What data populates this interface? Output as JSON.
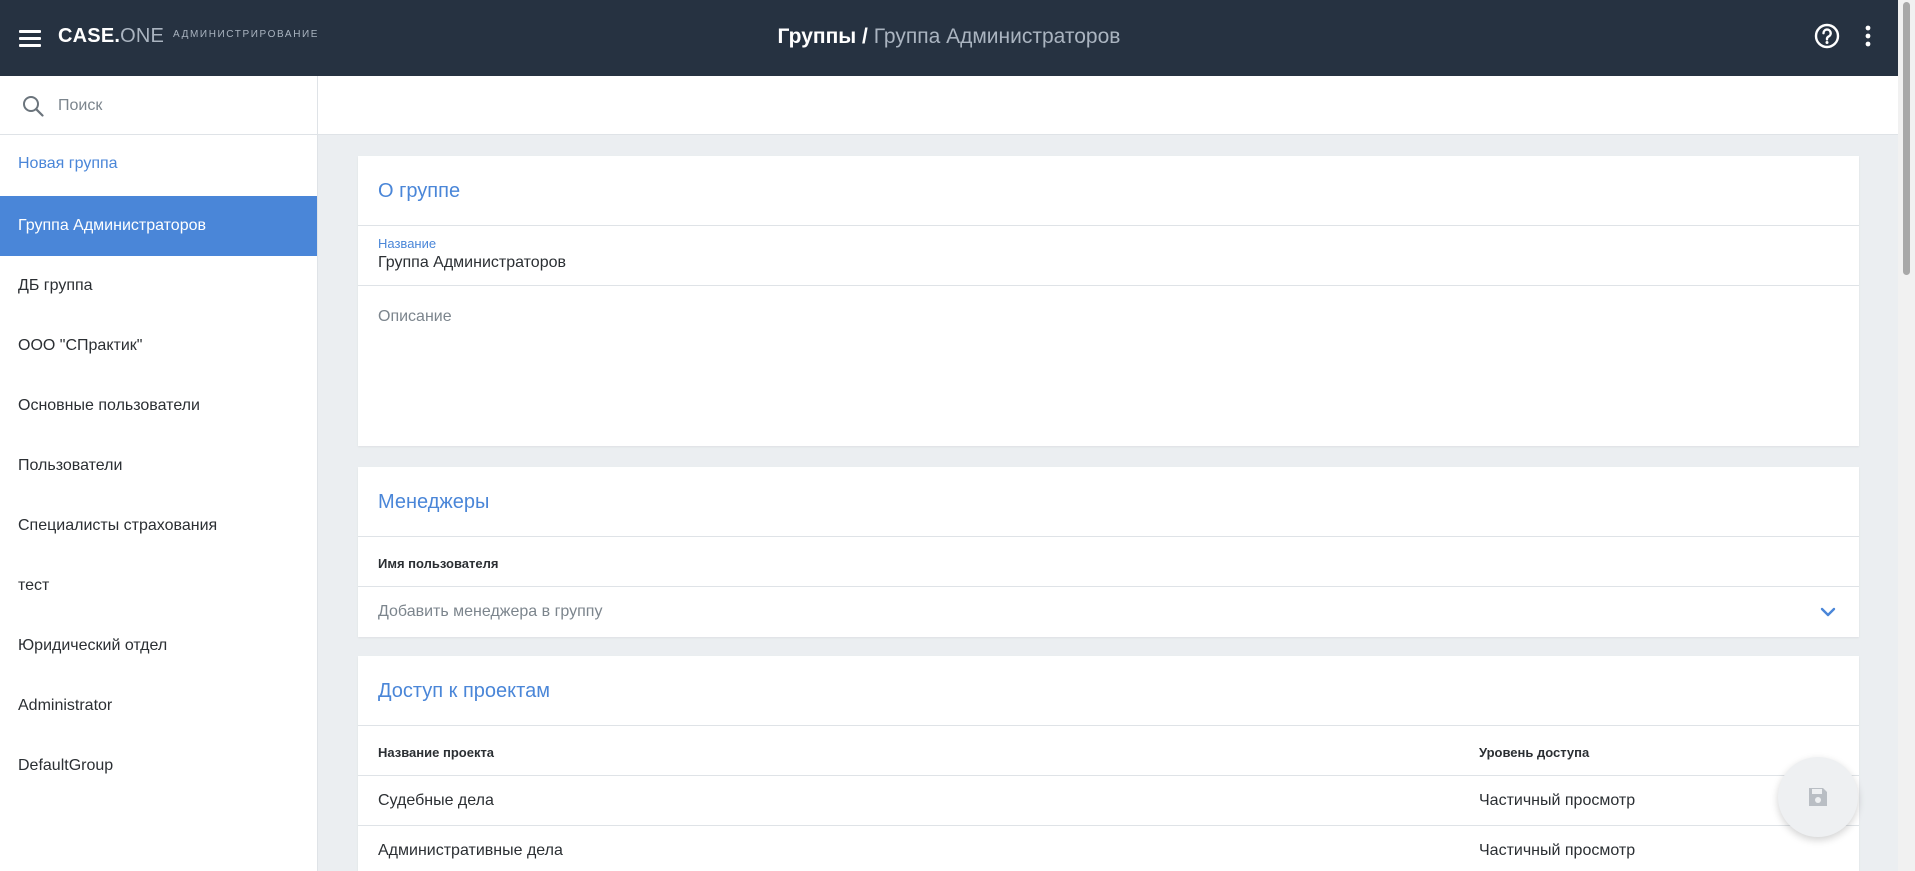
{
  "header": {
    "logo_primary": "CASE.",
    "logo_secondary": "ONE",
    "subtitle": "АДМИНИСТРИРОВАНИЕ",
    "breadcrumb_root": "Группы",
    "breadcrumb_separator": " / ",
    "breadcrumb_current": "Группа Администраторов"
  },
  "sidebar": {
    "search_placeholder": "Поиск",
    "new_group_label": "Новая группа",
    "groups": [
      {
        "label": "Группа Администраторов",
        "active": true
      },
      {
        "label": "ДБ группа"
      },
      {
        "label": "ООО \"СПрактик\""
      },
      {
        "label": "Основные пользователи"
      },
      {
        "label": "Пользователи"
      },
      {
        "label": "Специалисты страхования"
      },
      {
        "label": "тест"
      },
      {
        "label": "Юридический отдел"
      },
      {
        "label": "Administrator"
      },
      {
        "label": "DefaultGroup"
      }
    ]
  },
  "about": {
    "title": "О группе",
    "name_label": "Название",
    "name_value": "Группа Администраторов",
    "description_placeholder": "Описание"
  },
  "managers": {
    "title": "Менеджеры",
    "column_username": "Имя пользователя",
    "add_placeholder": "Добавить менеджера в группу"
  },
  "projects": {
    "title": "Доступ к проектам",
    "column_project": "Название проекта",
    "column_access": "Уровень доступа",
    "rows": [
      {
        "project": "Судебные дела",
        "access": "Частичный просмотр"
      },
      {
        "project": "Административные дела",
        "access": "Частичный просмотр"
      }
    ]
  },
  "colors": {
    "topbar": "#263241",
    "accent": "#4a86d8"
  },
  "icons": {
    "menu": "menu-icon",
    "help": "help-icon",
    "more": "more-vertical-icon",
    "search": "search-icon",
    "chevron": "chevron-down-icon",
    "save": "save-icon"
  }
}
